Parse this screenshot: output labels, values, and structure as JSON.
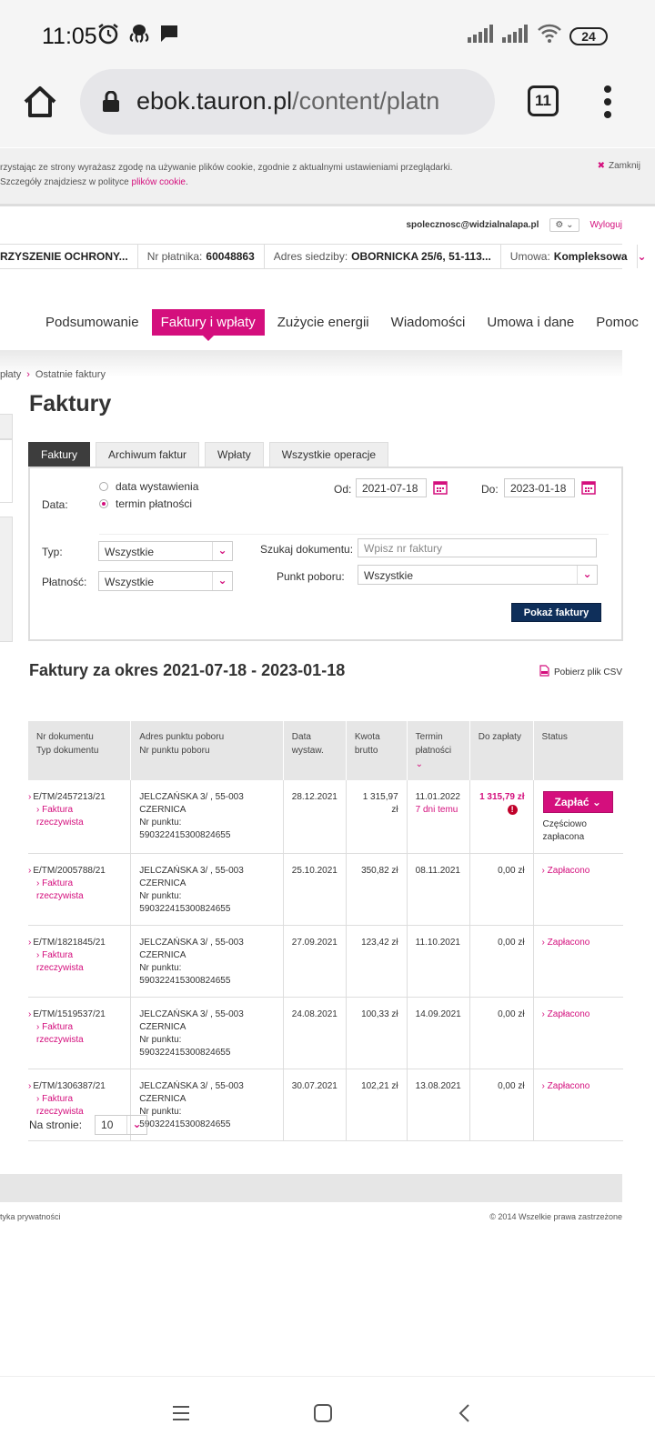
{
  "status_bar": {
    "time": "11:05",
    "battery": "24"
  },
  "browser": {
    "url_host": "ebok.tauron.pl",
    "url_path": "/content/platn",
    "tab_count": "11"
  },
  "cookie": {
    "line1": "rzystając ze strony wyrażasz zgodę na używanie plików cookie, zgodnie z aktualnymi ustawieniami przeglądarki.",
    "line2_prefix": "Szczegóły znajdziesz w polityce ",
    "line2_link": "plików cookie",
    "line2_suffix": ".",
    "close_label": "Zamknij"
  },
  "user": {
    "email": "spolecznosc@widzialnalapa.pl",
    "logout": "Wyloguj"
  },
  "infobar": {
    "name": "RZYSZENIE OCHRONY...",
    "payer_label": "Nr płatnika:",
    "payer_value": "60048863",
    "address_label": "Adres siedziby:",
    "address_value": "OBORNICKA 25/6, 51-113...",
    "contract_label": "Umowa:",
    "contract_value": "Kompleksowa"
  },
  "nav": {
    "items": [
      "Podsumowanie",
      "Faktury i wpłaty",
      "Zużycie energii",
      "Wiadomości",
      "Umowa i dane",
      "Pomoc"
    ]
  },
  "breadcrumb": {
    "parent": "płaty",
    "current": "Ostatnie faktury"
  },
  "page_title": "Faktury",
  "tabs": [
    "Faktury",
    "Archiwum faktur",
    "Wpłaty",
    "Wszystkie operacje"
  ],
  "filters": {
    "date_label": "Data:",
    "radio_issue": "data wystawienia",
    "radio_due": "termin płatności",
    "from_label": "Od:",
    "from_value": "2021-07-18",
    "to_label": "Do:",
    "to_value": "2023-01-18",
    "type_label": "Typ:",
    "type_value": "Wszystkie",
    "payment_label": "Płatność:",
    "payment_value": "Wszystkie",
    "search_label": "Szukaj dokumentu:",
    "search_placeholder": "Wpisz nr faktury",
    "point_label": "Punkt poboru:",
    "point_value": "Wszystkie",
    "show_button": "Pokaż faktury"
  },
  "section_title": "Faktury za okres 2021-07-18 - 2023-01-18",
  "csv_label": "Pobierz plik CSV",
  "table": {
    "headers": {
      "doc1": "Nr dokumentu",
      "doc2": "Typ dokumentu",
      "addr1": "Adres punktu poboru",
      "addr2": "Nr punktu poboru",
      "date1": "Data",
      "date2": "wystaw.",
      "amount1": "Kwota",
      "amount2": "brutto",
      "due1": "Termin",
      "due2": "płatności",
      "topay": "Do zapłaty",
      "status": "Status"
    },
    "rows": [
      {
        "doc": "E/TM/2457213/21",
        "type": "Faktura rzeczywista",
        "addr1": "JELCZAŃSKA 3/ , 55-003",
        "addr2": "CZERNICA",
        "point": "Nr punktu: 590322415300824655",
        "date": "28.12.2021",
        "amount": "1 315,97 zł",
        "due": "11.01.2022",
        "overdue": "7 dni temu",
        "topay": "1 315,79 zł",
        "status": "Częściowo zapłacona",
        "pay_button": "Zapłać"
      },
      {
        "doc": "E/TM/2005788/21",
        "type": "Faktura rzeczywista",
        "addr1": "JELCZAŃSKA 3/ , 55-003",
        "addr2": "CZERNICA",
        "point": "Nr punktu: 590322415300824655",
        "date": "25.10.2021",
        "amount": "350,82 zł",
        "due": "08.11.2021",
        "topay": "0,00 zł",
        "status": "Zapłacono"
      },
      {
        "doc": "E/TM/1821845/21",
        "type": "Faktura rzeczywista",
        "addr1": "JELCZAŃSKA 3/ , 55-003",
        "addr2": "CZERNICA",
        "point": "Nr punktu: 590322415300824655",
        "date": "27.09.2021",
        "amount": "123,42 zł",
        "due": "11.10.2021",
        "topay": "0,00 zł",
        "status": "Zapłacono"
      },
      {
        "doc": "E/TM/1519537/21",
        "type": "Faktura rzeczywista",
        "addr1": "JELCZAŃSKA 3/ , 55-003",
        "addr2": "CZERNICA",
        "point": "Nr punktu: 590322415300824655",
        "date": "24.08.2021",
        "amount": "100,33 zł",
        "due": "14.09.2021",
        "topay": "0,00 zł",
        "status": "Zapłacono"
      },
      {
        "doc": "E/TM/1306387/21",
        "type": "Faktura rzeczywista",
        "addr1": "JELCZAŃSKA 3/ , 55-003",
        "addr2": "CZERNICA",
        "point": "Nr punktu: 590322415300824655",
        "date": "30.07.2021",
        "amount": "102,21 zł",
        "due": "13.08.2021",
        "topay": "0,00 zł",
        "status": "Zapłacono"
      }
    ]
  },
  "per_page": {
    "label": "Na stronie:",
    "value": "10"
  },
  "footer": {
    "left": "tyka prywatności",
    "right": "© 2014 Wszelkie prawa zastrzeżone"
  },
  "colors": {
    "accent": "#d40f7d",
    "button_dark": "#0f2f5a"
  }
}
